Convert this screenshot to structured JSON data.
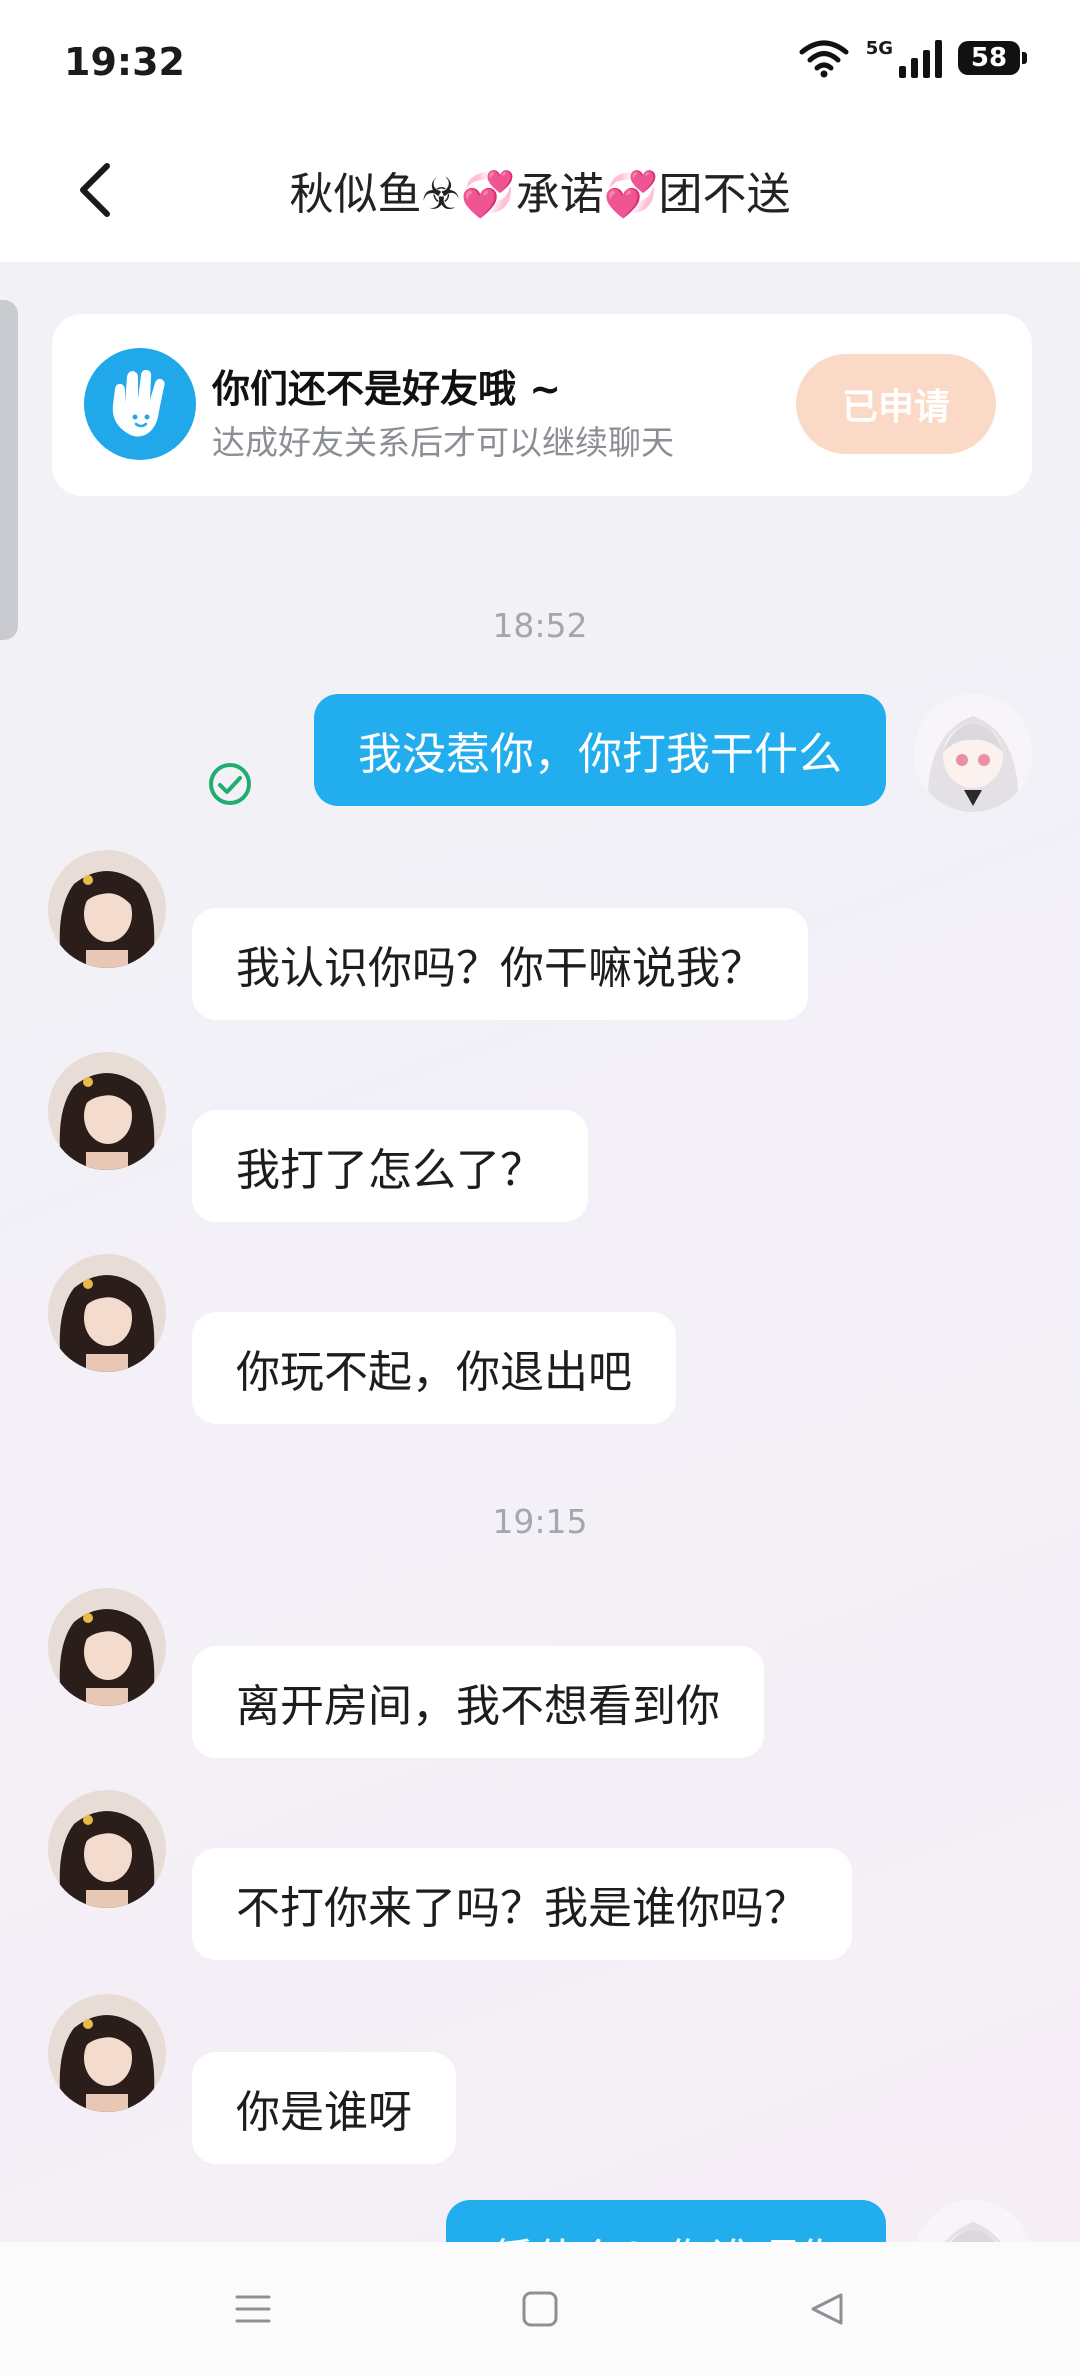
{
  "status_bar": {
    "time": "19:32",
    "network": "5G",
    "battery": "58"
  },
  "header": {
    "title": "秋似鱼☣💞承诺💞团不送",
    "back_icon": "chevron-left-icon"
  },
  "friend_banner": {
    "icon": "waving-hand-icon",
    "title": "你们还不是好友哦 ~",
    "subtitle": "达成好友关系后才可以继续聊天",
    "button_label": "已申请"
  },
  "chat": {
    "timestamp_1": "18:52",
    "timestamp_2": "19:15",
    "messages": [
      {
        "from": "me",
        "text": "我没惹你，你打我干什么"
      },
      {
        "from": "other",
        "text": "我认识你吗？你干嘛说我？"
      },
      {
        "from": "other",
        "text": "我打了怎么了？"
      },
      {
        "from": "other",
        "text": "你玩不起，你退出吧"
      },
      {
        "from": "other",
        "text": "离开房间，我不想看到你"
      },
      {
        "from": "other",
        "text": "不打你来了吗？我是谁你吗？"
      },
      {
        "from": "other",
        "text": "你是谁呀"
      },
      {
        "from": "me",
        "text": "凭什么？你谁呀你"
      }
    ]
  },
  "nav_bar": {
    "menu_icon": "menu-icon",
    "home_icon": "home-square-icon",
    "back_icon": "back-triangle-icon"
  },
  "colors": {
    "accent": "#22adee",
    "applied_button": "#fbd9c7",
    "read_check": "#1fae6f"
  }
}
